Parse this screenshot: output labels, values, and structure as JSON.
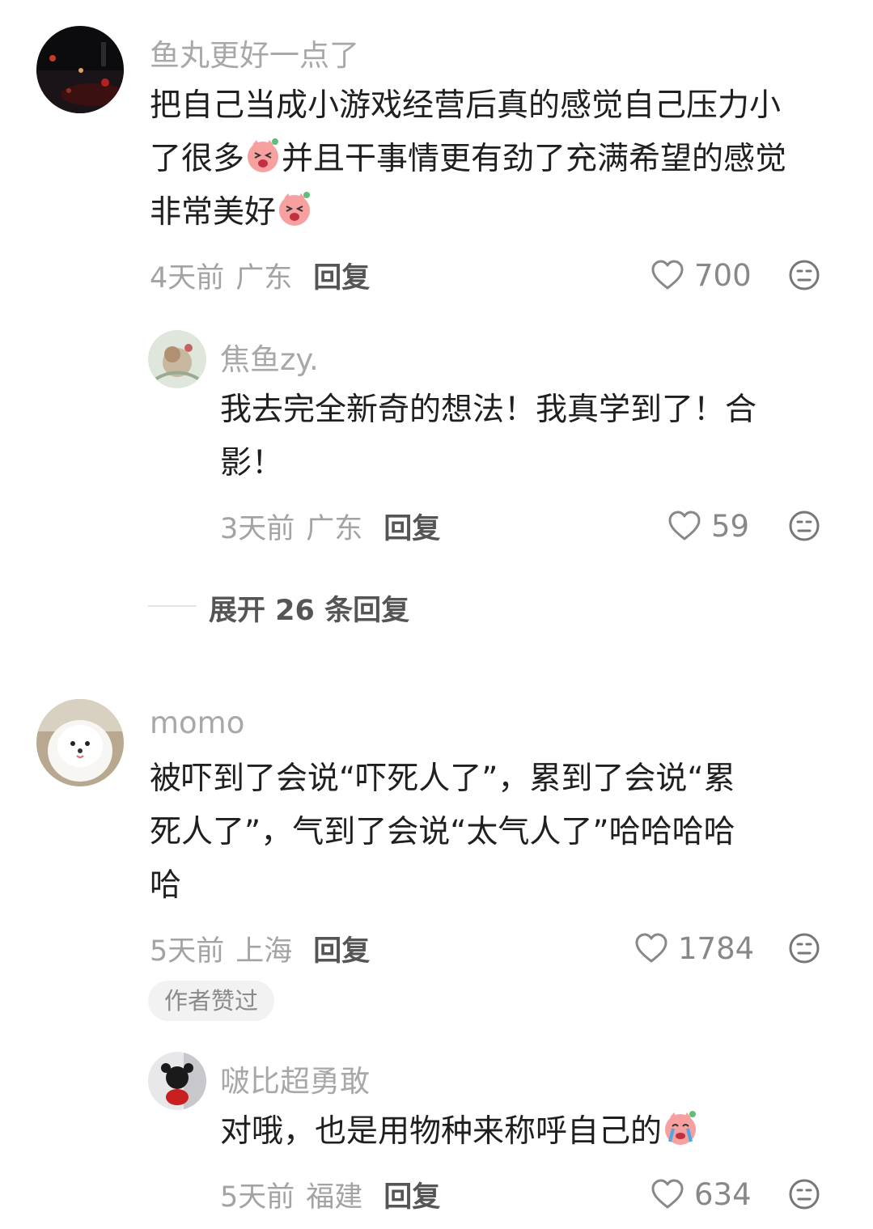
{
  "comments": [
    {
      "username": "鱼丸更好一点了",
      "text_lines": [
        "把自己当成小游戏经营后真的感觉自己压力小",
        "了很多",
        "并且干事情更有劲了充满希望的感觉",
        "非常美好"
      ],
      "time": "4天前",
      "location": "广东",
      "reply_label": "回复",
      "likes": "700",
      "reply": {
        "username": "焦鱼zy.",
        "text_lines": [
          "我去完全新奇的想法！我真学到了！合",
          "影！"
        ],
        "time": "3天前",
        "location": "广东",
        "reply_label": "回复",
        "likes": "59"
      },
      "expand_label": "展开 26 条回复"
    },
    {
      "username": "momo",
      "text_lines": [
        "被吓到了会说“吓死人了”，累到了会说“累",
        "死人了”，气到了会说“太气人了”哈哈哈哈",
        "哈"
      ],
      "time": "5天前",
      "location": "上海",
      "reply_label": "回复",
      "likes": "1784",
      "badge": "作者赞过",
      "reply": {
        "username": "啵比超勇敢",
        "text": "对哦，也是用物种来称呼自己的",
        "time": "5天前",
        "location": "福建",
        "reply_label": "回复",
        "likes": "634"
      }
    }
  ],
  "icons": {
    "like": "heart-outline-icon",
    "dislike": "meh-face-icon"
  }
}
